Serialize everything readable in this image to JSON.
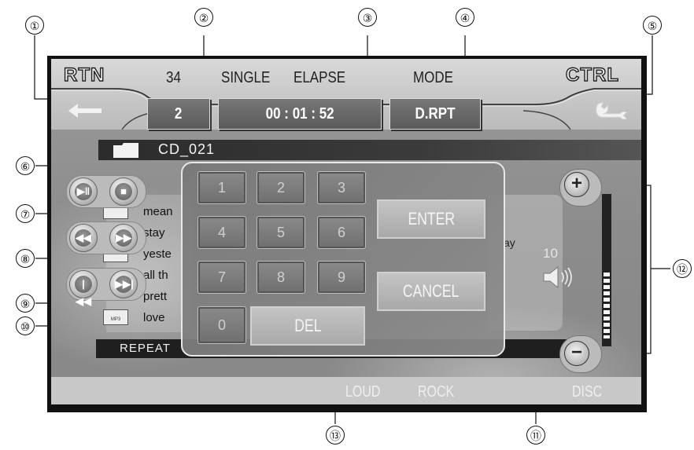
{
  "callouts": [
    "①",
    "②",
    "③",
    "④",
    "⑤",
    "⑥",
    "⑦",
    "⑧",
    "⑨",
    "⑩",
    "⑪",
    "⑫",
    "⑬"
  ],
  "header": {
    "rtn_label": "RTN",
    "track_count": "34",
    "single_label": "SINGLE",
    "elapse_label": "ELAPSE",
    "mode_label": "MODE",
    "ctrl_label": "CTRL"
  },
  "status": {
    "track_number": "2",
    "elapsed_time": "00 : 01 : 52",
    "mode_value": "D.RPT"
  },
  "folder": {
    "name": "CD_021"
  },
  "playlist": {
    "items": [
      "mean",
      "stay",
      "yeste",
      "all th",
      "prett",
      "love"
    ],
    "right_fragment": "ay",
    "icon_label": "MP3"
  },
  "repeat_label": "REPEAT",
  "keypad": {
    "digits": [
      "1",
      "2",
      "3",
      "4",
      "5",
      "6",
      "7",
      "8",
      "9",
      "0"
    ],
    "del_label": "DEL",
    "enter_label": "ENTER",
    "cancel_label": "CANCEL"
  },
  "volume": {
    "level": "10",
    "plus": "+",
    "minus": "−"
  },
  "bottom": {
    "loud": "LOUD",
    "rock": "ROCK",
    "disc": "DISC"
  },
  "icons": [
    "back-arrow-icon",
    "wrench-icon",
    "folder-icon",
    "play-pause-icon",
    "stop-icon",
    "rewind-icon",
    "fast-forward-icon",
    "previous-track-icon",
    "next-track-icon",
    "speaker-icon",
    "mp3-file-icon"
  ]
}
